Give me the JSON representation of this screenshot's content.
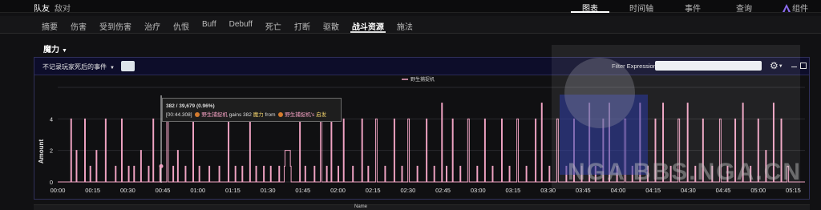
{
  "topbar": {
    "tabs_left": [
      "队友",
      "敌对"
    ],
    "tabs_right": [
      "图表",
      "时间轴",
      "事件",
      "查询",
      "组件"
    ],
    "active_right": 0
  },
  "subnav": {
    "tabs": [
      "摘要",
      "伤害",
      "受到伤害",
      "治疗",
      "仇恨",
      "Buff",
      "Debuff",
      "死亡",
      "打断",
      "驱散",
      "战斗资源",
      "施法"
    ],
    "active": 10
  },
  "resource_select": {
    "label": "魔力"
  },
  "panel": {
    "filter_dropdown": "不记录玩家死后的事件",
    "filter_expression_label": "Filter Expression:",
    "filter_expression_value": ""
  },
  "tooltip": {
    "line1": "382 / 39,679 (0.96%)",
    "time": "[00:44.308]",
    "source": "野生捕捉机",
    "gains": "gains 382",
    "resource": "魔力",
    "from": "from",
    "target": "野生捕捉机's",
    "ability": "启发"
  },
  "bottom_header": {
    "text": "Name"
  },
  "watermark_text": "NGA  BBS.NGA.CN",
  "colors": {
    "line": "#f0a3c3",
    "accent": "#ffffff",
    "panel_border": "#30305a"
  },
  "chart_data": {
    "type": "line",
    "series": [
      {
        "name": "野生捕捉机",
        "points": [
          [
            0,
            0
          ],
          [
            17,
            4
          ],
          [
            18,
            0
          ],
          [
            24,
            2
          ],
          [
            25,
            0
          ],
          [
            35,
            4
          ],
          [
            36,
            0
          ],
          [
            42,
            1
          ],
          [
            43,
            0
          ],
          [
            50,
            2
          ],
          [
            51,
            0
          ],
          [
            62,
            4
          ],
          [
            63,
            0
          ],
          [
            75,
            1
          ],
          [
            76,
            0
          ],
          [
            83,
            4
          ],
          [
            84,
            0
          ],
          [
            92,
            1
          ],
          [
            93,
            0
          ],
          [
            99,
            1
          ],
          [
            100,
            0
          ],
          [
            108,
            2
          ],
          [
            109,
            0
          ],
          [
            118,
            1
          ],
          [
            119,
            0
          ],
          [
            124,
            4
          ],
          [
            125,
            0
          ],
          [
            133,
            1
          ],
          [
            134,
            0
          ],
          [
            142,
            4
          ],
          [
            144,
            0
          ],
          [
            150,
            1
          ],
          [
            151,
            0
          ],
          [
            156,
            2
          ],
          [
            157,
            0
          ],
          [
            166,
            1
          ],
          [
            167,
            0
          ],
          [
            176,
            4
          ],
          [
            177,
            0
          ],
          [
            184,
            1
          ],
          [
            185,
            0
          ],
          [
            197,
            1
          ],
          [
            198,
            0
          ],
          [
            210,
            1
          ],
          [
            211,
            0
          ],
          [
            222,
            4
          ],
          [
            223,
            0
          ],
          [
            231,
            1
          ],
          [
            232,
            0
          ],
          [
            240,
            1
          ],
          [
            241,
            0
          ],
          [
            250,
            4
          ],
          [
            251,
            0
          ],
          [
            258,
            1
          ],
          [
            259,
            0
          ],
          [
            268,
            1
          ],
          [
            269,
            0
          ],
          [
            277,
            1
          ],
          [
            278,
            0
          ],
          [
            288,
            1
          ],
          [
            289,
            0
          ],
          [
            295,
            1
          ],
          [
            296,
            2
          ],
          [
            302,
            2
          ],
          [
            303,
            1
          ],
          [
            304,
            0
          ],
          [
            315,
            4
          ],
          [
            316,
            0
          ],
          [
            322,
            1
          ],
          [
            323,
            0
          ],
          [
            334,
            1
          ],
          [
            335,
            0
          ],
          [
            342,
            4
          ],
          [
            344,
            0
          ],
          [
            350,
            1
          ],
          [
            351,
            0
          ],
          [
            356,
            4
          ],
          [
            357,
            0
          ],
          [
            365,
            1
          ],
          [
            366,
            0
          ],
          [
            372,
            4
          ],
          [
            373,
            0
          ],
          [
            384,
            1
          ],
          [
            385,
            0
          ],
          [
            396,
            4
          ],
          [
            397,
            0
          ],
          [
            404,
            1
          ],
          [
            405,
            0
          ],
          [
            414,
            4
          ],
          [
            416,
            0
          ],
          [
            426,
            1
          ],
          [
            427,
            0
          ],
          [
            438,
            4
          ],
          [
            439,
            0
          ],
          [
            448,
            1
          ],
          [
            449,
            0
          ],
          [
            456,
            4
          ],
          [
            458,
            0
          ],
          [
            468,
            1
          ],
          [
            469,
            0
          ],
          [
            480,
            4
          ],
          [
            481,
            0
          ],
          [
            490,
            1
          ],
          [
            491,
            0
          ],
          [
            500,
            5
          ],
          [
            501,
            0
          ],
          [
            506,
            1
          ],
          [
            507,
            0
          ],
          [
            514,
            4
          ],
          [
            515,
            0
          ],
          [
            524,
            1
          ],
          [
            525,
            0
          ],
          [
            534,
            4
          ],
          [
            536,
            0
          ],
          [
            546,
            1
          ],
          [
            547,
            0
          ],
          [
            556,
            4
          ],
          [
            557,
            0
          ],
          [
            566,
            1
          ],
          [
            567,
            0
          ],
          [
            578,
            4
          ],
          [
            579,
            0
          ],
          [
            588,
            1
          ],
          [
            589,
            0
          ],
          [
            598,
            4
          ],
          [
            600,
            0
          ],
          [
            610,
            1
          ],
          [
            611,
            0
          ],
          [
            622,
            4
          ],
          [
            623,
            0
          ],
          [
            630,
            5
          ],
          [
            631,
            0
          ],
          [
            640,
            1
          ],
          [
            641,
            0
          ],
          [
            650,
            4
          ],
          [
            652,
            0
          ],
          [
            662,
            1
          ],
          [
            663,
            0
          ],
          [
            672,
            4
          ],
          [
            673,
            0
          ],
          [
            682,
            1
          ],
          [
            683,
            0
          ],
          [
            692,
            5
          ],
          [
            693,
            0
          ],
          [
            700,
            1
          ],
          [
            701,
            0
          ],
          [
            710,
            4
          ],
          [
            711,
            0
          ],
          [
            718,
            5
          ],
          [
            719,
            0
          ],
          [
            728,
            1
          ],
          [
            729,
            0
          ],
          [
            738,
            4
          ],
          [
            740,
            0
          ],
          [
            748,
            1
          ],
          [
            749,
            0
          ],
          [
            758,
            5
          ],
          [
            759,
            0
          ],
          [
            768,
            1
          ],
          [
            769,
            0
          ],
          [
            778,
            4
          ],
          [
            779,
            0
          ],
          [
            788,
            5
          ],
          [
            789,
            0
          ],
          [
            798,
            1
          ],
          [
            799,
            0
          ],
          [
            808,
            4
          ],
          [
            810,
            0
          ],
          [
            820,
            5
          ],
          [
            821,
            0
          ],
          [
            830,
            1
          ],
          [
            831,
            0
          ],
          [
            840,
            4
          ],
          [
            841,
            0
          ],
          [
            852,
            1
          ],
          [
            853,
            0
          ],
          [
            862,
            4
          ],
          [
            864,
            0
          ],
          [
            872,
            1
          ],
          [
            873,
            0
          ],
          [
            882,
            4
          ],
          [
            883,
            0
          ],
          [
            892,
            5
          ],
          [
            893,
            0
          ],
          [
            902,
            1
          ],
          [
            903,
            0
          ],
          [
            912,
            4
          ],
          [
            913,
            0
          ],
          [
            922,
            2
          ],
          [
            923,
            0
          ],
          [
            932,
            5
          ],
          [
            933,
            0
          ],
          [
            942,
            4
          ],
          [
            943,
            0
          ],
          [
            950,
            1
          ],
          [
            952,
            0
          ]
        ]
      }
    ],
    "x_ticks": [
      "00:00",
      "00:15",
      "00:30",
      "00:45",
      "01:00",
      "01:15",
      "01:30",
      "01:45",
      "02:00",
      "02:15",
      "02:30",
      "02:45",
      "03:00",
      "03:15",
      "03:30",
      "03:45",
      "04:00",
      "04:15",
      "04:30",
      "04:45",
      "05:00",
      "05:15"
    ],
    "y_ticks": [
      "0",
      "2",
      "4"
    ],
    "ylabel": "Amount",
    "ylim": [
      0,
      6
    ],
    "xlim": [
      0,
      320
    ],
    "legend_position": "top-center",
    "grid": true,
    "cursor_x_seconds": 44.3
  }
}
